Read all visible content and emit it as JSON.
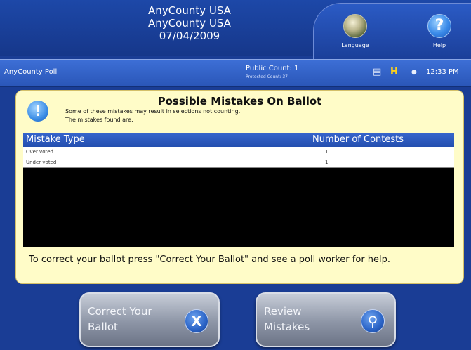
{
  "header": {
    "line1": "AnyCounty USA",
    "line2": "AnyCounty USA",
    "date": "07/04/2009",
    "language_label": "Language",
    "help_label": "Help",
    "language_icon": "globe-language-icon",
    "help_icon": "question-mark-icon"
  },
  "status": {
    "poll_name": "AnyCounty Poll",
    "public_count": "Public Count: 1",
    "protected_count": "Protected Count: 37",
    "time": "12:33 PM"
  },
  "panel": {
    "title": "Possible Mistakes On Ballot",
    "subtitle1": "Some of these mistakes may result in selections not counting.",
    "subtitle2": "The mistakes found are:",
    "table": {
      "headers": [
        "Mistake Type",
        "Number of Contests"
      ],
      "rows": [
        {
          "type": "Over voted",
          "count": "1"
        },
        {
          "type": "Under voted",
          "count": "1"
        }
      ]
    },
    "instructions": "To correct your ballot press \"Correct Your Ballot\" and see a poll worker for help."
  },
  "buttons": {
    "correct_line1": "Correct Your",
    "correct_line2": "Ballot",
    "correct_icon": "x-icon",
    "review_line1": "Review",
    "review_line2": "Mistakes",
    "review_icon": "magnifier-icon"
  },
  "colors": {
    "background": "#1a3d95",
    "panel": "#fffcc8",
    "table_header": "#3665cc"
  }
}
